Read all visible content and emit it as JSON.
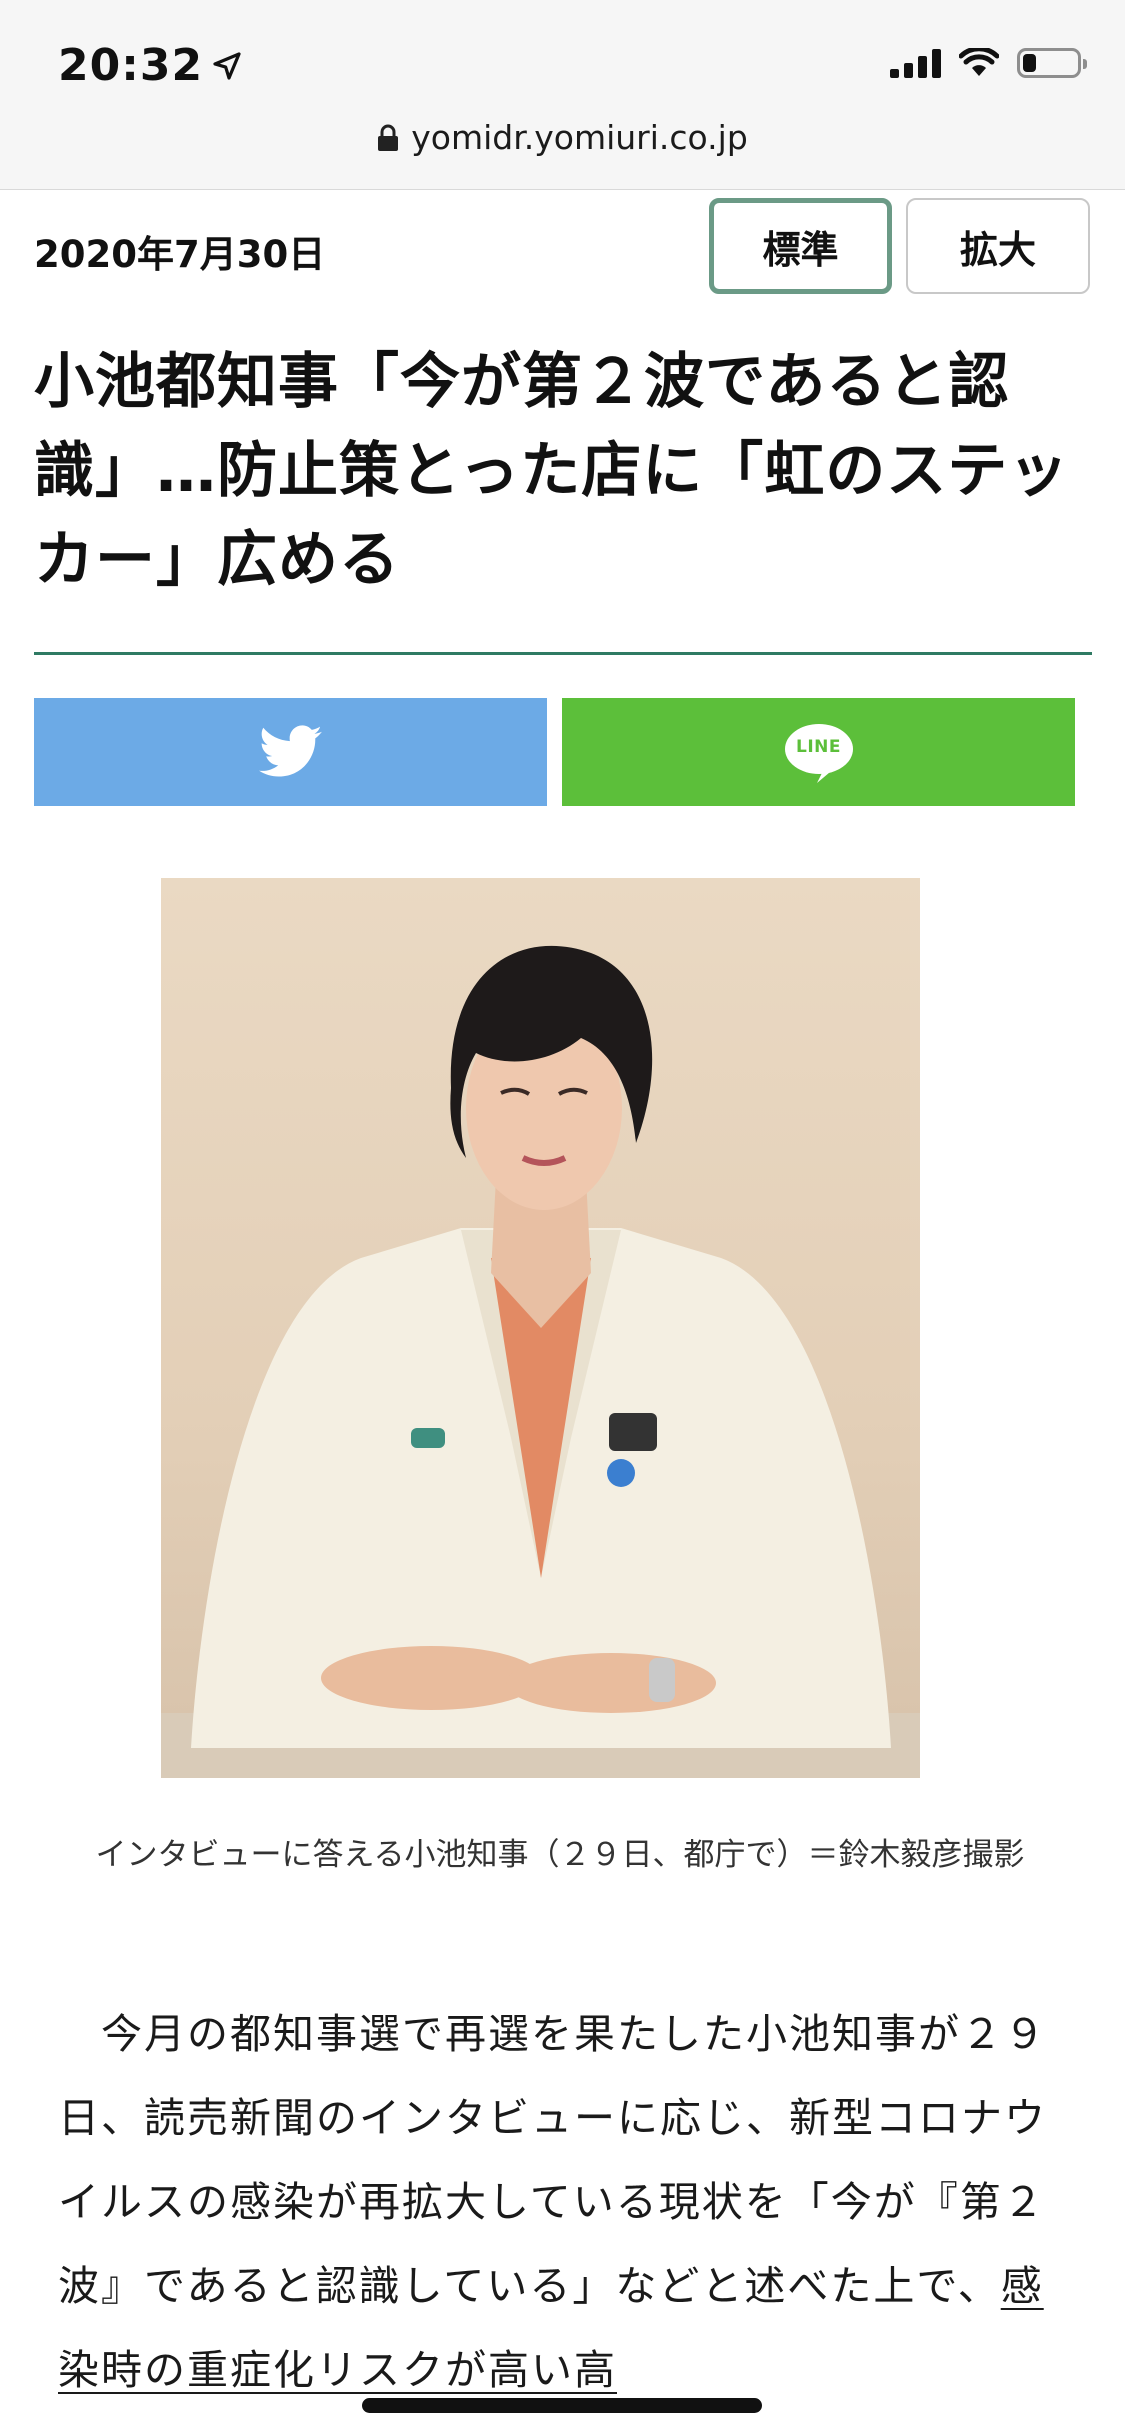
{
  "status_bar": {
    "time": "20:32",
    "icons": [
      "location-arrow-icon",
      "cellular-signal-icon",
      "wifi-icon",
      "battery-icon"
    ],
    "battery_level": 0.25
  },
  "browser": {
    "url": "yomidr.yomiuri.co.jp"
  },
  "article": {
    "date": "2020年7月30日",
    "font_size_buttons": {
      "standard": "標準",
      "large": "拡大",
      "selected": "標準"
    },
    "headline": "小池都知事「今が第２波であると認識」…防止策とった店に「虹のステッカー」広める",
    "share": {
      "twitter_icon": "twitter-bird-icon",
      "line_icon": "line-icon",
      "line_label": "LINE"
    },
    "photo": {
      "caption": "インタビューに答える小池知事（２９日、都庁で）＝鈴木毅彦撮影"
    },
    "body_start": "今月の都知事選で再選を果たした小池知事が２９日、読売新聞のインタビューに応じ、新型コロナウイルスの感染が再拡大している現状を「今が『第２波』であると認識している」などと述べた上で、",
    "body_link": "感染時の重症化リスクが高い高"
  },
  "colors": {
    "twitter": "#6caae6",
    "line": "#5cbf3a",
    "accent_green": "#2f7a63",
    "selected_border": "#6b9a86"
  }
}
